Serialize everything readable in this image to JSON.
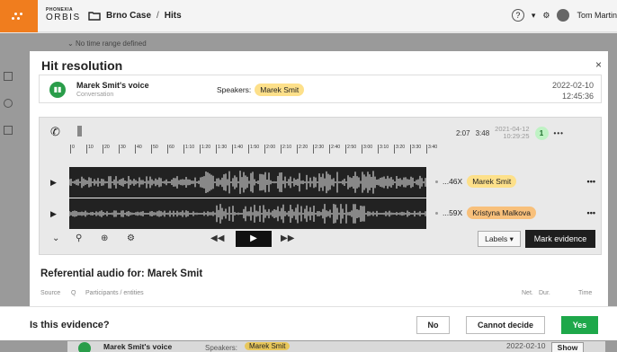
{
  "header": {
    "brand_top": "PHONEXIA",
    "brand_bottom": "ORBIS",
    "case": "Brno Case",
    "separator": "/",
    "section": "Hits",
    "user": "Tom Martin"
  },
  "background": {
    "filter_text": "No time range defined"
  },
  "modal": {
    "title": "Hit resolution",
    "close": "×",
    "conversation": {
      "name": "Marek Smit's voice",
      "subtitle": "Conversation",
      "speakers_label": "Speakers:",
      "speaker": "Marek Smit",
      "date": "2022-02-10",
      "time": "12:45:36"
    },
    "player": {
      "time_a": "2:07",
      "time_b": "3:48",
      "date": "2021-04-12",
      "time": "10:29:25",
      "count": "1",
      "ruler_ticks": [
        "0",
        "10",
        "20",
        "30",
        "40",
        "50",
        "60",
        "1:10",
        "1:20",
        "1:30",
        "1:40",
        "1:50",
        "2:00",
        "2:10",
        "2:20",
        "2:30",
        "2:40",
        "2:50",
        "3:00",
        "3:10",
        "3:20",
        "3:30",
        "3:40"
      ],
      "tracks": [
        {
          "value": "...46X",
          "speaker": "Marek Smit",
          "color": "#fde08a"
        },
        {
          "value": "...59X",
          "speaker": "Kristyna Malkova",
          "color": "#f8c07b"
        }
      ],
      "labels_button": "Labels",
      "mark_button": "Mark evidence"
    },
    "referential": {
      "title": "Referential audio for: Marek Smit",
      "columns": [
        "Source",
        "Q",
        "Participants / entities",
        "Net.",
        "Dur.",
        "Time"
      ]
    }
  },
  "evidence_bar": {
    "question": "Is this evidence?",
    "no": "No",
    "cannot": "Cannot decide",
    "yes": "Yes"
  },
  "underlying_row": {
    "name": "Marek Smit's voice",
    "speakers_label": "Speakers:",
    "speaker": "Marek Smit",
    "date": "2022-02-10",
    "show": "Show"
  },
  "colors": {
    "brand": "#f07d1e",
    "accent_green": "#1ea84a",
    "highlight": "#fde08a"
  }
}
